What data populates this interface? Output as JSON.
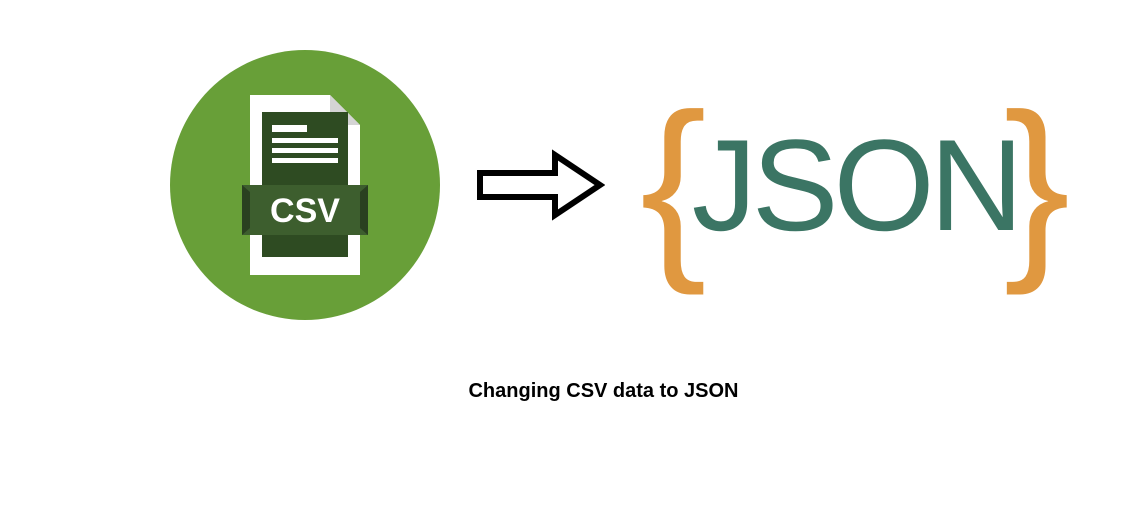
{
  "diagram": {
    "source_format": "CSV",
    "target_format": "JSON",
    "caption": "Changing CSV data to JSON"
  },
  "icons": {
    "csv_label": "CSV",
    "json_label": "JSON",
    "brace_open": "{",
    "brace_close": "}"
  },
  "colors": {
    "csv_circle": "#689f38",
    "csv_file_dark": "#2e4b22",
    "csv_file_band": "#3d5e2e",
    "json_text": "#3b7564",
    "json_brace": "#e09840"
  }
}
